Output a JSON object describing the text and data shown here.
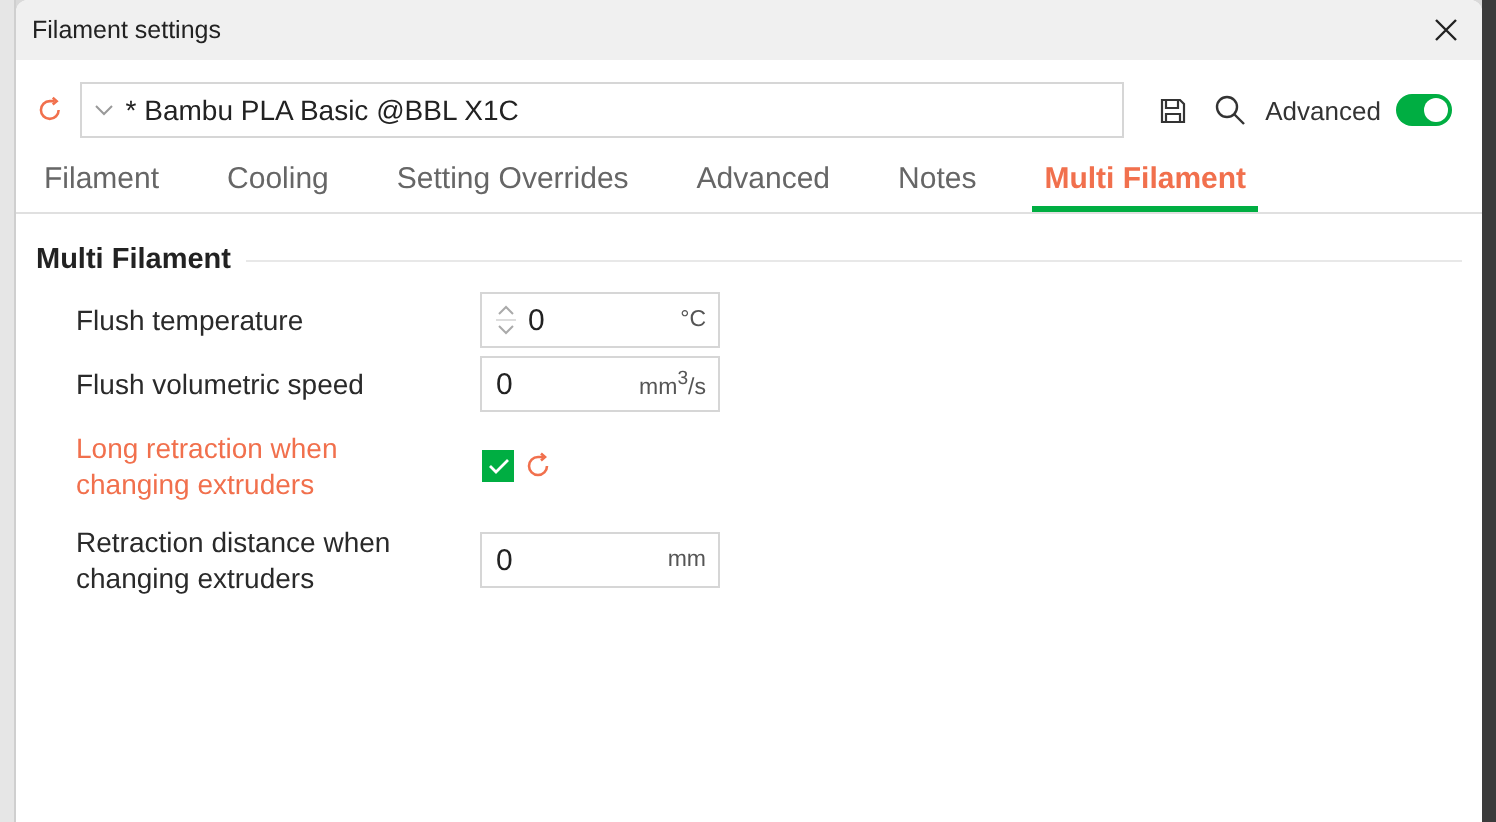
{
  "window": {
    "title": "Filament settings"
  },
  "preset": {
    "value": "* Bambu PLA Basic @BBL X1C"
  },
  "advanced": {
    "label": "Advanced",
    "on": true
  },
  "tabs": [
    {
      "label": "Filament",
      "selected": false
    },
    {
      "label": "Cooling",
      "selected": false
    },
    {
      "label": "Setting Overrides",
      "selected": false
    },
    {
      "label": "Advanced",
      "selected": false
    },
    {
      "label": "Notes",
      "selected": false
    },
    {
      "label": "Multi Filament",
      "selected": true
    }
  ],
  "section": {
    "title": "Multi Filament"
  },
  "options": [
    {
      "kind": "number",
      "label": "Flush temperature",
      "value": "0",
      "unit": "°C",
      "spinner": true,
      "modified": false
    },
    {
      "kind": "number",
      "label": "Flush volumetric speed",
      "value": "0",
      "unit": "mm$^{3}$/s",
      "spinner": false,
      "modified": false
    },
    {
      "kind": "checkbox",
      "label": "Long retraction when changing extruders",
      "checked": true,
      "modified": true
    },
    {
      "kind": "number",
      "label": "Retraction distance when changing extruders",
      "value": "0",
      "unit": "mm",
      "spinner": false,
      "modified": false
    }
  ]
}
